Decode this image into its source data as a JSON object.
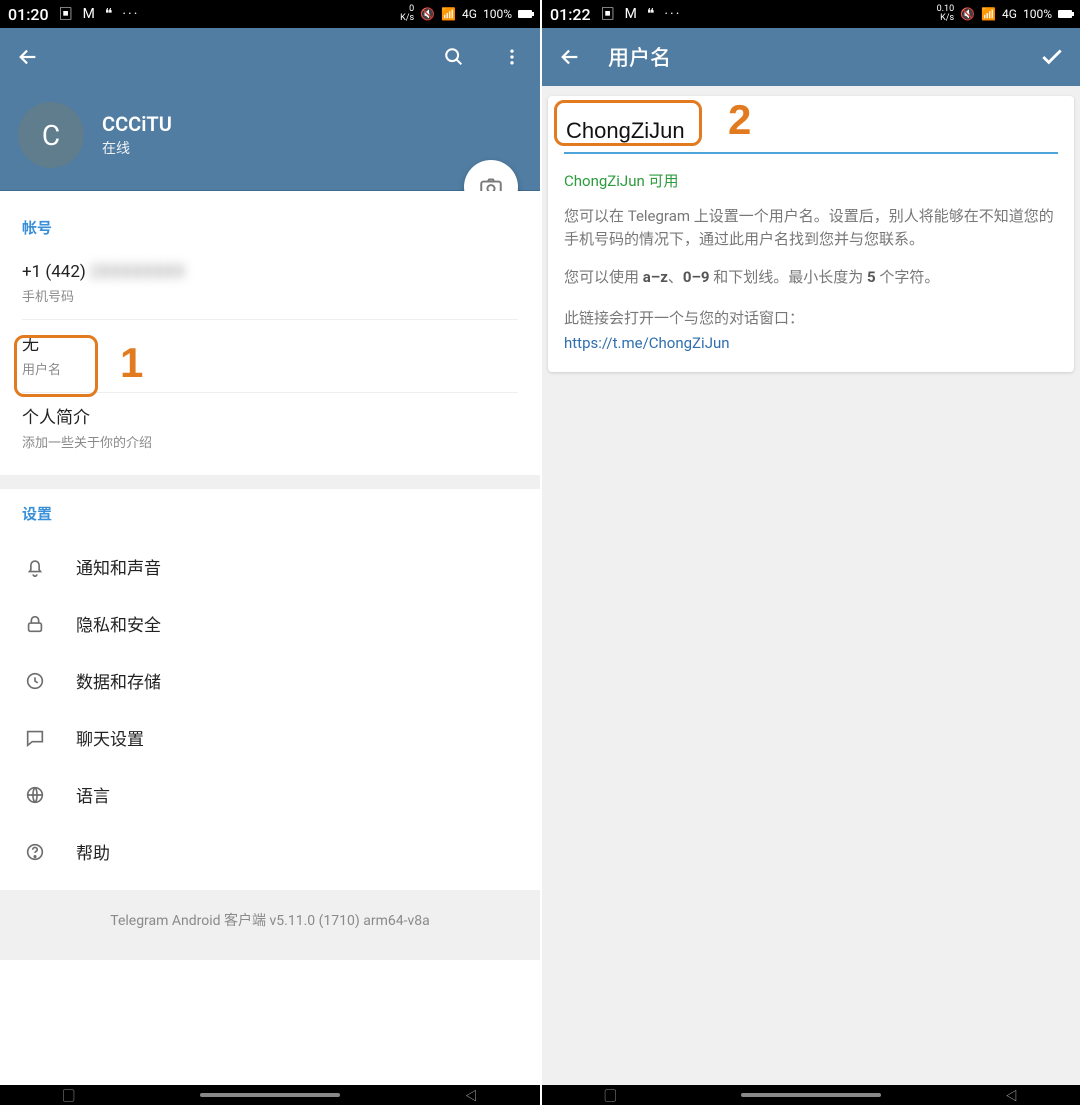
{
  "left": {
    "status": {
      "time": "01:20",
      "net": "0\nK/s",
      "signal": "4G",
      "battery": "100%"
    },
    "toolbar": {
      "search": "search",
      "more": "more"
    },
    "profile": {
      "initial": "C",
      "name": "CCCiTU",
      "status": "在线"
    },
    "account": {
      "title": "帐号",
      "phone_value": "+1 (442)",
      "phone_hidden": "2XXXXXXXX",
      "phone_label": "手机号码",
      "username_value": "无",
      "username_label": "用户名",
      "bio_value": "个人简介",
      "bio_label": "添加一些关于你的介绍"
    },
    "settings": {
      "title": "设置",
      "items": [
        {
          "icon": "bell",
          "label": "通知和声音"
        },
        {
          "icon": "lock",
          "label": "隐私和安全"
        },
        {
          "icon": "clock",
          "label": "数据和存储"
        },
        {
          "icon": "chat",
          "label": "聊天设置"
        },
        {
          "icon": "globe",
          "label": "语言"
        },
        {
          "icon": "help",
          "label": "帮助"
        }
      ]
    },
    "footer": "Telegram Android 客户端 v5.11.0 (1710) arm64-v8a",
    "annotation": "1"
  },
  "right": {
    "status": {
      "time": "01:22",
      "net": "0.10\nK/s",
      "signal": "4G",
      "battery": "100%"
    },
    "toolbar": {
      "title": "用户名"
    },
    "username_value": "ChongZiJun",
    "available_text": "ChongZiJun 可用",
    "desc1": "您可以在 Telegram 上设置一个用户名。设置后，别人将能够在不知道您的手机号码的情况下，通过此用户名找到您并与您联系。",
    "desc2_prefix": "您可以使用 ",
    "desc2_bold1": "a–z",
    "desc2_mid1": "、",
    "desc2_bold2": "0–9",
    "desc2_mid2": " 和下划线。最小长度为 ",
    "desc2_bold3": "5",
    "desc2_suffix": " 个字符。",
    "link_intro": "此链接会打开一个与您的对话窗口：",
    "link": "https://t.me/ChongZiJun",
    "annotation": "2"
  }
}
